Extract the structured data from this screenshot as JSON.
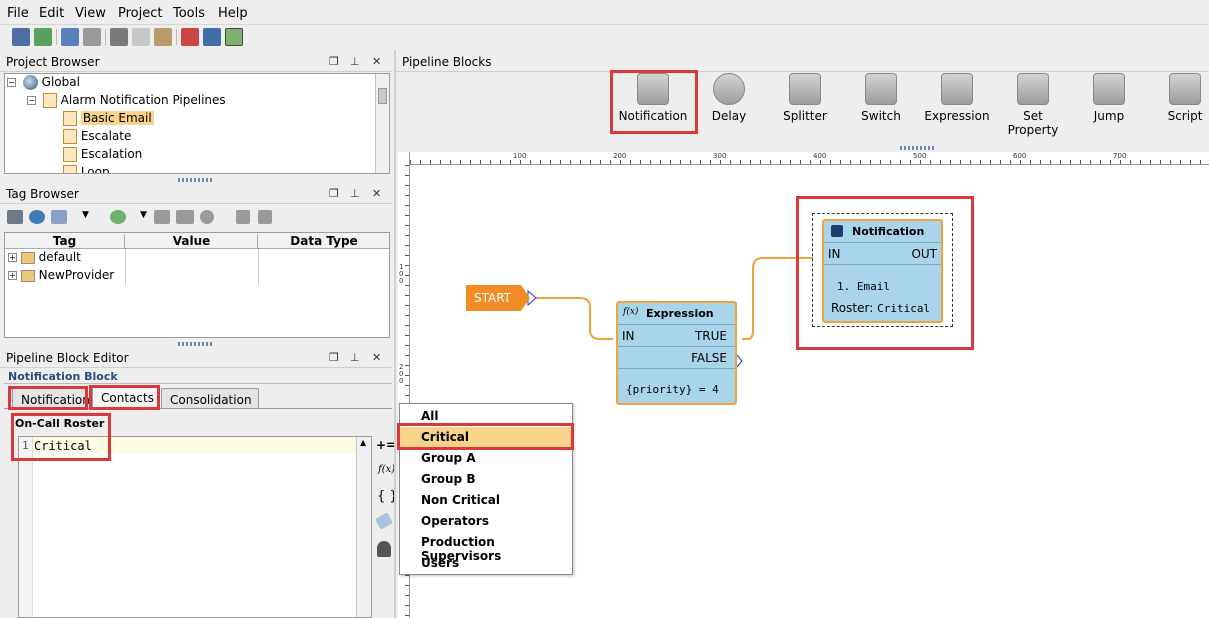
{
  "menu": [
    "File",
    "Edit",
    "View",
    "Project",
    "Tools",
    "Help"
  ],
  "project_browser": {
    "title": "Project Browser",
    "items": [
      {
        "label": "Global"
      },
      {
        "label": "Alarm Notification Pipelines"
      },
      {
        "label": "Basic Email"
      },
      {
        "label": "Escalate"
      },
      {
        "label": "Escalation"
      },
      {
        "label": "Loop"
      }
    ]
  },
  "tag_browser": {
    "title": "Tag Browser",
    "columns": [
      "Tag",
      "Value",
      "Data Type"
    ],
    "rows": [
      {
        "label": "default"
      },
      {
        "label": "NewProvider"
      }
    ]
  },
  "block_editor": {
    "title": "Pipeline Block Editor",
    "section": "Notification Block",
    "tabs": [
      "Notification",
      "Contacts",
      "Consolidation"
    ],
    "roster_label": "On-Call Roster",
    "line_number": "1",
    "roster_value": "Critical",
    "side_icons": [
      "+=",
      "f(x)",
      "{ }"
    ]
  },
  "pipeline_blocks": {
    "title": "Pipeline Blocks",
    "items": [
      "Notification",
      "Delay",
      "Splitter",
      "Switch",
      "Expression",
      "Set Property",
      "Jump",
      "Script"
    ]
  },
  "ruler": {
    "h_labels": [
      "100",
      "200",
      "300",
      "400",
      "500",
      "600",
      "700"
    ],
    "v_labels": [
      "100",
      "200"
    ]
  },
  "canvas": {
    "start_label": "START",
    "expression_node": {
      "title": "Expression",
      "icon": "f(x)",
      "in": "IN",
      "true": "TRUE",
      "false": "FALSE",
      "expr": "{priority} = 4"
    },
    "notification_node": {
      "title": "Notification",
      "in": "IN",
      "out": "OUT",
      "line1": "1. Email",
      "roster_label": "Roster:",
      "roster_value": "Critical"
    }
  },
  "dropdown": {
    "items": [
      "All",
      "Critical",
      "Group A",
      "Group B",
      "Non Critical",
      "Operators",
      "Production Supervisors",
      "Users"
    ],
    "selected": "Critical"
  },
  "colors": {
    "node_fill": "#a9d5ea",
    "node_border": "#f0a23c",
    "start_fill": "#f28c24",
    "highlight": "#d9393a",
    "selected_item": "#f8d48a"
  }
}
